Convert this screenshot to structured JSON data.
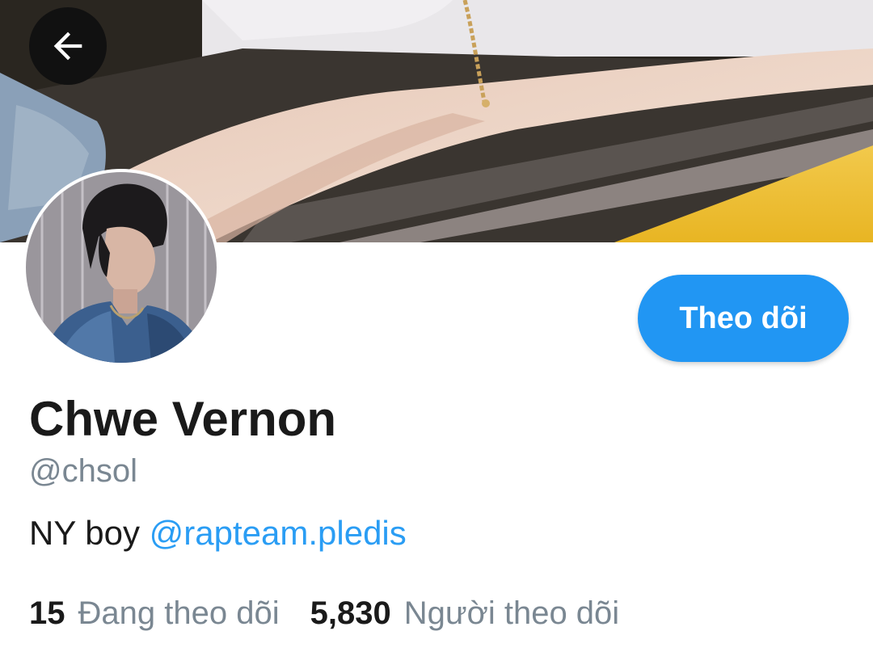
{
  "header": {
    "back_icon": "arrow-left-icon",
    "banner_image": "profile banner photo (arm with gold bracelet on yellow taxi)"
  },
  "profile": {
    "avatar_image": "profile photo (person in denim jacket)",
    "display_name": "Chwe Vernon",
    "handle": "@chsol",
    "bio_text": "NY boy ",
    "bio_mention": "@rapteam.pledis",
    "follow_label": "Theo dõi"
  },
  "stats": {
    "following_count": "15",
    "following_label": "Đang theo dõi",
    "followers_count": "5,830",
    "followers_label": "Người theo dõi"
  },
  "colors": {
    "accent": "#2196f3",
    "mention": "#2a9df4",
    "secondary_text": "#7a8792",
    "primary_text": "#1a1a1a"
  }
}
